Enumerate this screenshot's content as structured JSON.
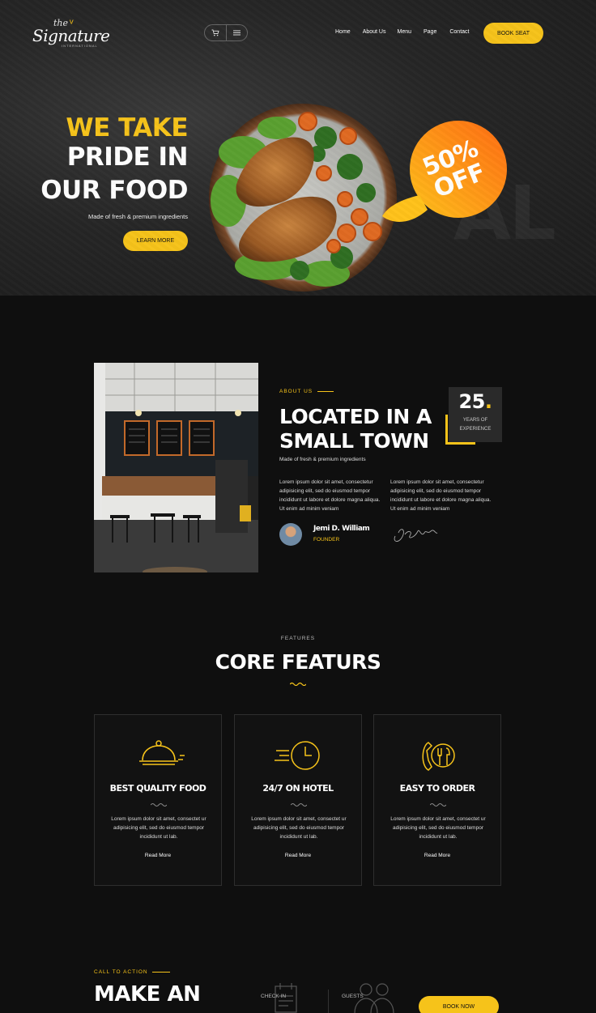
{
  "brand": {
    "the": "the",
    "name": "Signature",
    "tagline": "INTERNATIONAL"
  },
  "header": {
    "nav": [
      "Home",
      "About Us",
      "Menu",
      "Page",
      "Contact"
    ],
    "cta": "BOOK SEAT",
    "icons": [
      "cart-icon",
      "menu-icon"
    ]
  },
  "hero": {
    "line1": "WE TAKE",
    "line2": "PRIDE IN",
    "line3": "OUR FOOD",
    "subtitle": "Made of fresh & premium ingredients",
    "button": "LEARN MORE",
    "promo_line1": "50%",
    "promo_line2": "OFF"
  },
  "about": {
    "eyebrow": "ABOUT US",
    "title_line1": "LOCATED IN A",
    "title_line2": "SMALL TOWN",
    "subtitle": "Made of fresh & premium ingredients",
    "para_left": "Lorem ipsum dolor sit amet, consectetur adipisicing elit, sed do eiusmod tempor incididunt ut labore et dolore magna aliqua. Ut enim ad minim veniam",
    "para_right": "Lorem ipsum dolor sit amet, consectetur adipisicing elit, sed do eiusmod tempor incididunt ut labore et dolore magna aliqua. Ut enim ad minim veniam",
    "years": "25",
    "years_label1": "YEARS OF",
    "years_label2": "EXPERIENCE",
    "founder_name": "Jemi D. William",
    "founder_role": "FOUNDER"
  },
  "features": {
    "eyebrow": "FEATURES",
    "title": "CORE FEATURS",
    "cards": [
      {
        "icon": "cloche-icon",
        "title": "BEST QUALITY FOOD",
        "text": "Lorem ipsum dolor sit amet, consectet ur adipisicing elit, sed do eiusmod tempor incididunt ut lab.",
        "link": "Read More"
      },
      {
        "icon": "clock-icon",
        "title": "24/7 ON HOTEL",
        "text": "Lorem ipsum dolor sit amet, consectet ur adipisicing elit, sed do eiusmod tempor incididunt ut lab.",
        "link": "Read More"
      },
      {
        "icon": "phone-utensils-icon",
        "title": "EASY TO ORDER",
        "text": "Lorem ipsum dolor sit amet, consectet ur adipisicing elit, sed do eiusmod tempor incididunt ut lab.",
        "link": "Read More"
      }
    ]
  },
  "cta": {
    "eyebrow": "CALL TO ACTION",
    "title": "MAKE AN",
    "checkin": "CHECK IN",
    "guests": "GUESTS",
    "button": "BOOK NOW"
  },
  "colors": {
    "accent": "#f6c31a",
    "background": "#0f0f0f",
    "card_border": "#2e2e2e"
  }
}
